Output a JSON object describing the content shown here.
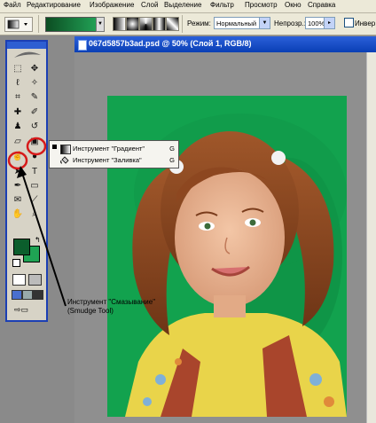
{
  "menu": [
    "Файл",
    "Редактирование",
    "Изображение",
    "Слой",
    "Выделение",
    "Фильтр",
    "Просмотр",
    "Окно",
    "Справка"
  ],
  "options": {
    "mode_label": "Режим:",
    "mode_value": "Нормальный",
    "opacity_label": "Непрозр.:",
    "opacity_value": "100%",
    "invert_label": "Инвер"
  },
  "document": {
    "title": "067d5857b3ad.psd @ 50% (Слой 1, RGB/8)"
  },
  "flyout": [
    {
      "label": "Инструмент \"Градиент\"",
      "key": "G",
      "icon": "gradient-icon",
      "selected": true
    },
    {
      "label": "Инструмент \"Заливка\"",
      "key": "G",
      "icon": "paint-bucket-icon",
      "selected": false
    }
  ],
  "callout": {
    "line1": "Инструмент \"Смазывание\"",
    "line2": "(Smudge Tool)"
  },
  "colors": {
    "foreground": "#0b5e2c",
    "background": "#1fa454",
    "canvas": "#12a24e",
    "highlight_circle": "#d61a1a"
  }
}
